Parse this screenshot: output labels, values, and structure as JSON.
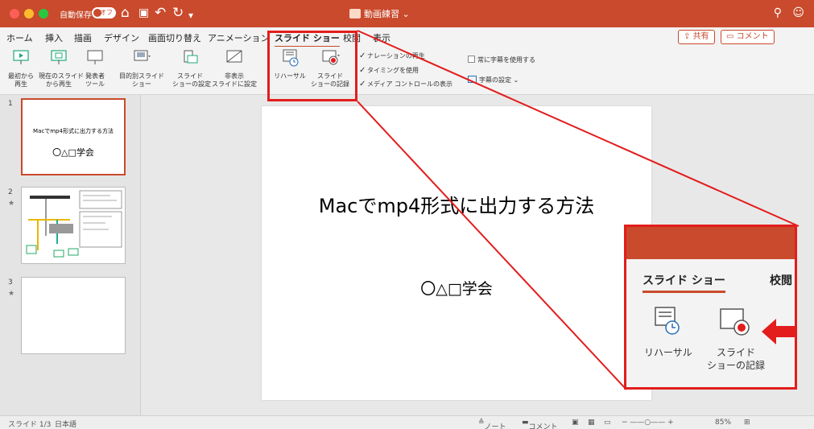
{
  "titlebar": {
    "autosave_label": "自動保存",
    "autosave_state": "オフ",
    "doc_title": "動画練習",
    "search_icon": "search-icon",
    "account_icon": "smiley-icon"
  },
  "tabs": [
    "ホーム",
    "挿入",
    "描画",
    "デザイン",
    "画面切り替え",
    "アニメーション",
    "スライド ショー",
    "校閲",
    "表示"
  ],
  "active_tab": "スライド ショー",
  "share_label": "共有",
  "comment_label": "コメント",
  "ribbon": {
    "from_start": "最初から\n再生",
    "from_current": "現在のスライド\nから再生",
    "presenter": "発表者\nツール",
    "custom": "目的別スライド\nショー",
    "setup": "スライド\nショーの設定",
    "hide": "非表示\nスライドに設定",
    "rehearse": "リハーサル",
    "record": "スライド\nショーの記録",
    "narration": "ナレーションの再生",
    "timing": "タイミングを使用",
    "media": "メディア コントロールの表示",
    "subtitles_always": "常に字幕を使用する",
    "subtitle_settings": "字幕の設定"
  },
  "thumbnails": [
    {
      "number": "1",
      "title": "Macでmp4形式に出力する方法",
      "subtitle": "〇△□学会"
    },
    {
      "number": "2"
    },
    {
      "number": "3"
    }
  ],
  "slide": {
    "title": "Macでmp4形式に出力する方法",
    "subtitle": "〇△□学会"
  },
  "status": {
    "slide_pos": "スライド 1/3",
    "language": "日本語",
    "notes": "ノート",
    "comments": "コメント",
    "zoom": "85%"
  },
  "zoom_callout": {
    "tab_active": "スライド ショー",
    "tab_next": "校閲",
    "rehearse": "リハーサル",
    "record": "スライド\nショーの記録"
  },
  "colors": {
    "accent": "#c94a2c",
    "highlight": "#e31c1c"
  }
}
